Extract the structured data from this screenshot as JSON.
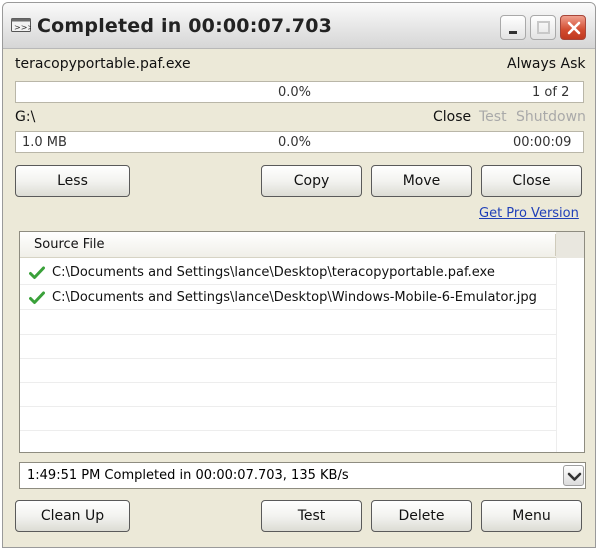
{
  "window": {
    "title": "Completed in 00:00:07.703",
    "icon": "teracopy-app-icon"
  },
  "source": {
    "file_name": "teracopyportable.paf.exe",
    "overwrite_mode": "Always Ask",
    "progress": "0.0%",
    "file_count": "1 of 2"
  },
  "target": {
    "path": "G:\\",
    "after_options": [
      "Close",
      "Test",
      "Shutdown"
    ],
    "size": "1.0 MB",
    "progress": "0.0%",
    "time": "00:00:09"
  },
  "buttons": {
    "less": "Less",
    "copy": "Copy",
    "move": "Move",
    "close": "Close",
    "clean_up": "Clean Up",
    "test": "Test",
    "delete": "Delete",
    "menu": "Menu"
  },
  "pro_link": "Get Pro Version",
  "file_list": {
    "column": "Source File",
    "rows": [
      {
        "status_icon": "checkmark-icon",
        "path": "C:\\Documents and Settings\\lance\\Desktop\\teracopyportable.paf.exe"
      },
      {
        "status_icon": "checkmark-icon",
        "path": "C:\\Documents and Settings\\lance\\Desktop\\Windows-Mobile-6-Emulator.jpg"
      }
    ]
  },
  "status_log": "1:49:51 PM Completed in 00:00:07.703, 135 KB/s",
  "colors": {
    "window_bg": "#ece9d8",
    "link": "#1f3fb8",
    "check": "#3aa13a",
    "close_button": "#d24c30"
  }
}
